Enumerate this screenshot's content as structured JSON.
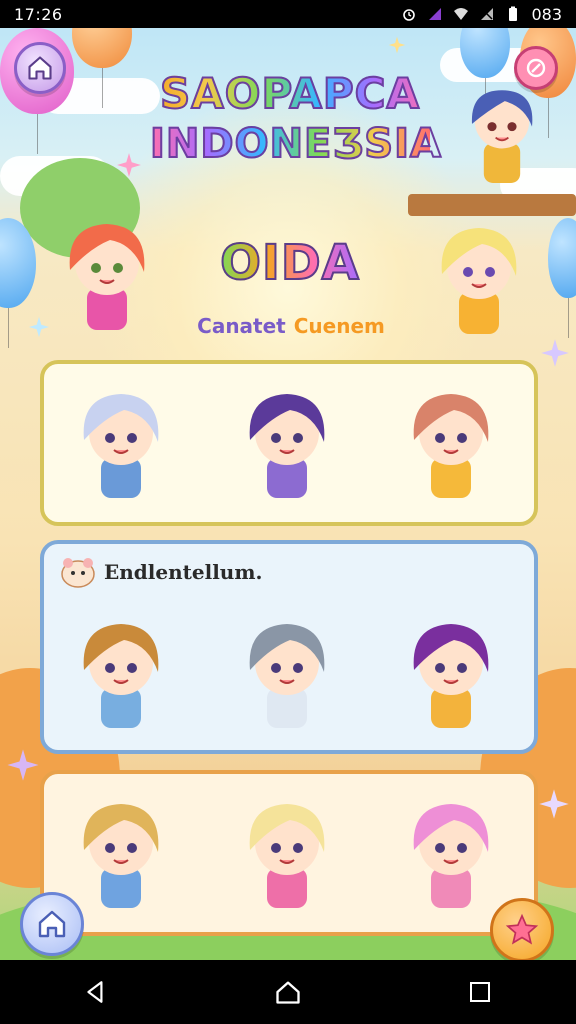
{
  "status_bar": {
    "time": "17:26",
    "battery": "083"
  },
  "game": {
    "title_line1": "SAOPAPCA",
    "title_line2": "INDONEƷSIA",
    "logo_text": "OIDA",
    "subtitle_a": "Canatet",
    "subtitle_b": "Cuenem",
    "panel2_title": "Endlentellum."
  },
  "characters": {
    "top_left": {
      "hair": "#f26b4a",
      "dress": "#e855a8"
    },
    "top_right": {
      "hair": "#f6e27a",
      "dress": "#f7b233"
    },
    "corner_right": {
      "hair": "#4a5fb5",
      "dress": "#f0b73a"
    },
    "panel1": [
      {
        "hair": "#c8d2f0",
        "dress": "#6a9ad8"
      },
      {
        "hair": "#5b3a9a",
        "dress": "#8c6bd1"
      },
      {
        "hair": "#d9836a",
        "dress": "#f5b93a"
      }
    ],
    "panel2": [
      {
        "hair": "#c98a3a",
        "dress": "#78aee0"
      },
      {
        "hair": "#8a96a6",
        "dress": "#dfe8f2"
      },
      {
        "hair": "#7a2f9e",
        "dress": "#f3b33c"
      }
    ],
    "panel3": [
      {
        "hair": "#e0b45a",
        "dress": "#6fa3e0"
      },
      {
        "hair": "#f5e39a",
        "dress": "#ee6fa8"
      },
      {
        "hair": "#ee8fd6",
        "dress": "#f08ab8"
      }
    ]
  },
  "colors": {
    "accent_purple": "#6b3fa0",
    "home_button": "#d7b6f5",
    "star_button": "#f5a623"
  }
}
